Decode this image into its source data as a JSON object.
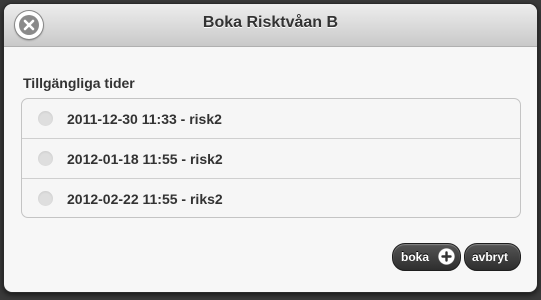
{
  "dialog": {
    "title": "Boka Risktvåan B",
    "close_icon": "close-icon"
  },
  "section": {
    "label": "Tillgängliga tider"
  },
  "times": [
    {
      "label": "2011-12-30 11:33 - risk2",
      "selected": false
    },
    {
      "label": "2012-01-18 11:55 - risk2",
      "selected": false
    },
    {
      "label": "2012-02-22 11:55 - riks2",
      "selected": false
    }
  ],
  "buttons": {
    "book_label": "boka",
    "book_icon": "plus-icon",
    "cancel_label": "avbryt"
  },
  "colors": {
    "button_bg": "#3a3a3a",
    "header_bg": "#d6d6d6",
    "radio_unselected": "#dedede"
  }
}
